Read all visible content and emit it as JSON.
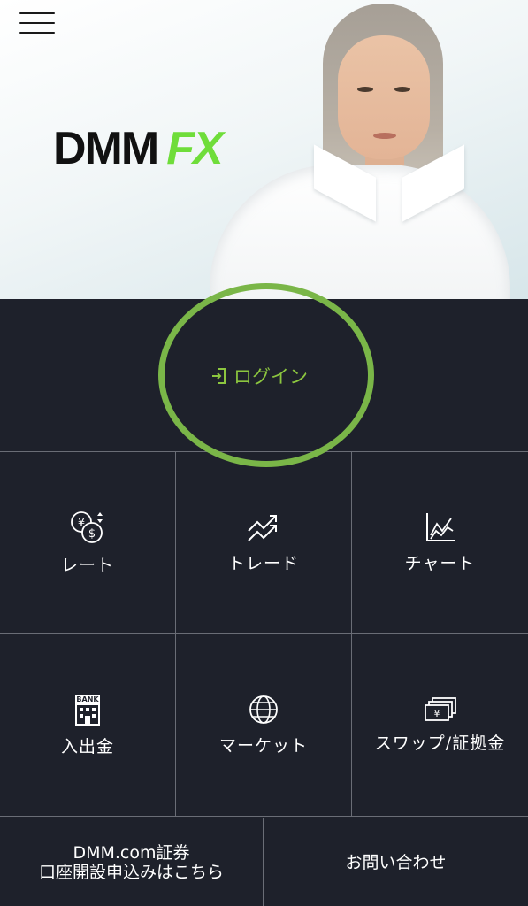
{
  "header": {
    "logo_primary": "DMM",
    "logo_secondary": "FX"
  },
  "login": {
    "label": "ログイン"
  },
  "menu": [
    {
      "label": "レート",
      "icon": "currency-exchange-icon"
    },
    {
      "label": "トレード",
      "icon": "trend-arrows-icon"
    },
    {
      "label": "チャート",
      "icon": "chart-icon"
    },
    {
      "label": "入出金",
      "icon": "bank-icon",
      "icon_text": "BANK"
    },
    {
      "label": "マーケット",
      "icon": "globe-icon"
    },
    {
      "label": "スワップ/証拠金",
      "icon": "banknotes-icon"
    }
  ],
  "footer": {
    "account_line1": "DMM.com証券",
    "account_line2": "口座開設申込みはこちら",
    "contact": "お問い合わせ"
  },
  "colors": {
    "background": "#1e212b",
    "accent": "#8cc63f",
    "highlight_ring": "#7ab648",
    "divider": "#6a6d76"
  }
}
